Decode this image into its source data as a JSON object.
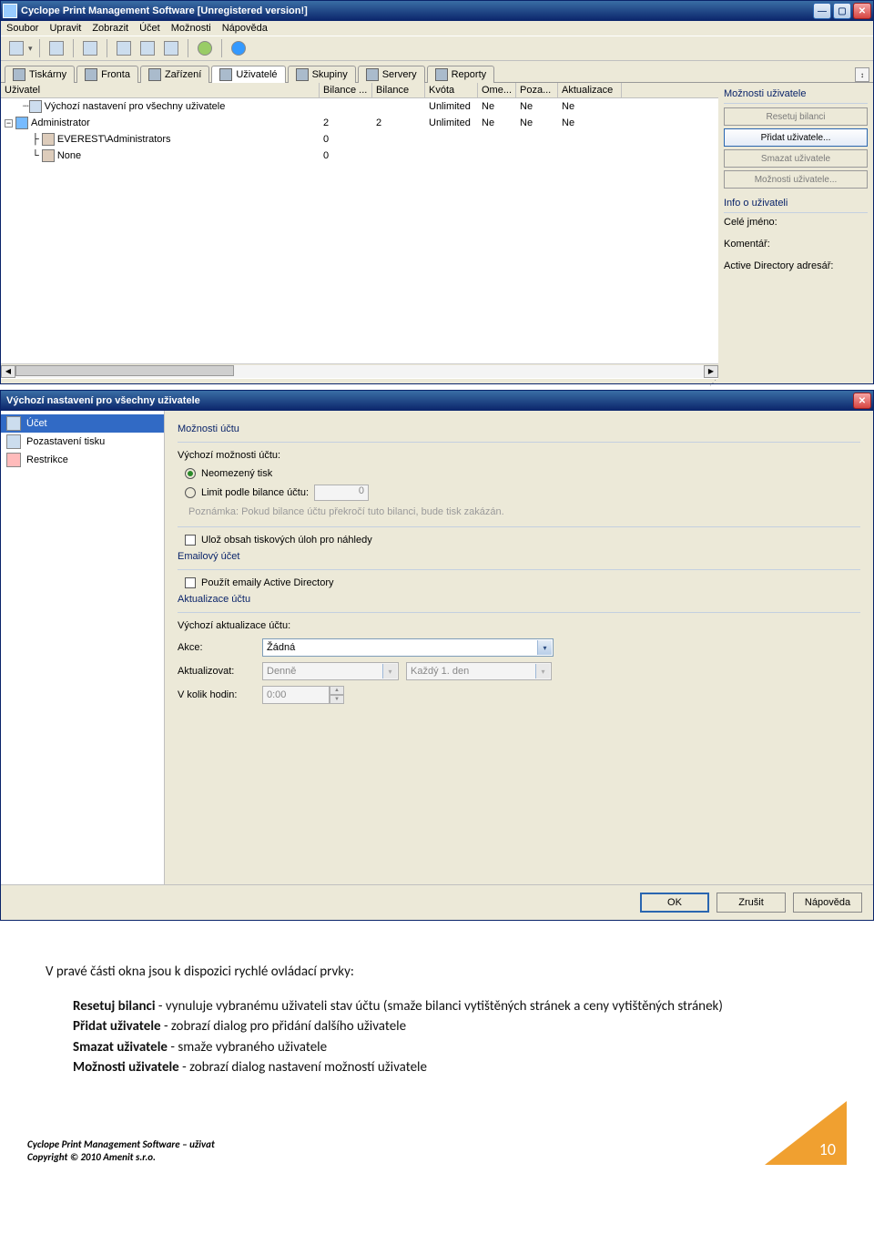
{
  "mainwin": {
    "title": "Cyclope Print Management Software [Unregistered version!]",
    "menu": [
      "Soubor",
      "Upravit",
      "Zobrazit",
      "Účet",
      "Možnosti",
      "Nápověda"
    ],
    "tabs": [
      {
        "label": "Tiskárny"
      },
      {
        "label": "Fronta"
      },
      {
        "label": "Zařízení"
      },
      {
        "label": "Uživatelé",
        "active": true
      },
      {
        "label": "Skupiny"
      },
      {
        "label": "Servery"
      },
      {
        "label": "Reporty"
      }
    ],
    "grid": {
      "cols": [
        "Uživatel",
        "Bilance ...",
        "Bilance",
        "Kvóta",
        "Ome...",
        "Poza...",
        "Aktualizace"
      ],
      "rows": [
        {
          "indent": 1,
          "icon": "gear",
          "label": "Výchozí nastavení pro všechny uživatele",
          "cells": [
            "",
            "",
            "Unlimited",
            "Ne",
            "Ne",
            "Ne"
          ]
        },
        {
          "indent": 0,
          "expander": "-",
          "icon": "user",
          "label": "Administrator",
          "cells": [
            "2",
            "2",
            "Unlimited",
            "Ne",
            "Ne",
            "Ne"
          ]
        },
        {
          "indent": 2,
          "icon": "group",
          "label": "EVEREST\\Administrators",
          "cells": [
            "0",
            "",
            "",
            "",
            "",
            ""
          ]
        },
        {
          "indent": 2,
          "icon": "group",
          "label": "None",
          "cells": [
            "0",
            "",
            "",
            "",
            "",
            ""
          ]
        }
      ]
    },
    "side": {
      "group1_title": "Možnosti uživatele",
      "btn_reset": "Resetuj bilanci",
      "btn_add": "Přidat uživatele...",
      "btn_del": "Smazat uživatele",
      "btn_opts": "Možnosti uživatele...",
      "group2_title": "Info o uživateli",
      "lbl_name": "Celé jméno:",
      "lbl_comment": "Komentář:",
      "lbl_ad": "Active Directory adresář:"
    }
  },
  "dialog": {
    "title": "Výchozí nastavení pro všechny uživatele",
    "nav": [
      {
        "label": "Účet",
        "selected": true
      },
      {
        "label": "Pozastavení tisku"
      },
      {
        "label": "Restrikce"
      }
    ],
    "acct": {
      "group_title": "Možnosti účtu",
      "lbl_default": "Výchozí možnosti účtu:",
      "radio_unlimited": "Neomezený tisk",
      "radio_limit": "Limit podle bilance účtu:",
      "limit_value": "0",
      "note": "Poznámka: Pokud bilance účtu překročí tuto bilanci, bude tisk zakázán.",
      "cb_save": "Ulož obsah tiskových úloh pro náhledy"
    },
    "email": {
      "group_title": "Emailový účet",
      "cb_ad": "Použít emaily Active Directory"
    },
    "update": {
      "group_title": "Aktualizace účtu",
      "lbl_default": "Výchozí aktualizace účtu:",
      "lbl_action": "Akce:",
      "action_value": "Žádná",
      "lbl_upd": "Aktualizovat:",
      "upd_value": "Denně",
      "upd2_value": "Každý 1. den",
      "lbl_time": "V kolik hodin:",
      "time_value": "0:00"
    },
    "buttons": {
      "ok": "OK",
      "cancel": "Zrušit",
      "help": "Nápověda"
    }
  },
  "doc": {
    "intro": "V pravé části okna jsou k dispozici rychlé ovládací prvky:",
    "items": [
      {
        "b": "Resetuj bilanci",
        "t": " - vynuluje vybranému uživateli stav účtu (smaže bilanci vytištěných stránek a ceny vytištěných stránek)"
      },
      {
        "b": "Přidat uživatele",
        "t": " - zobrazí dialog pro přidání dalšího uživatele"
      },
      {
        "b": "Smazat uživatele",
        "t": " - smaže vybraného uživatele"
      },
      {
        "b": "Možnosti uživatele",
        "t": " - zobrazí dialog nastavení možností uživatele"
      }
    ],
    "footer1": "Cyclope Print Management Software – uživat",
    "footer2": "Copyright © 2010 Amenit s.r.o.",
    "page": "10"
  }
}
